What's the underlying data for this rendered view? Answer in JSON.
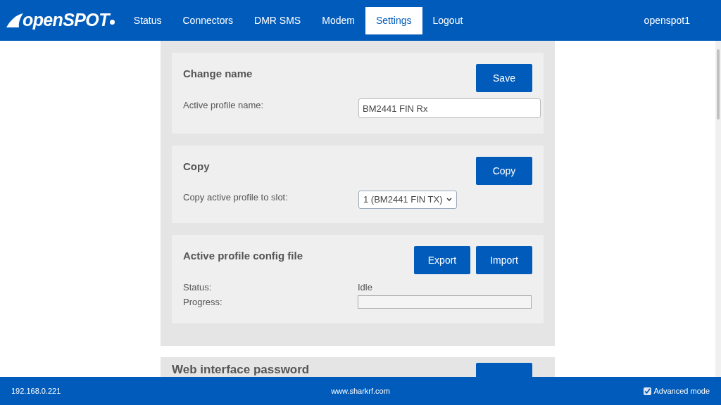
{
  "header": {
    "logo": "openSPOT",
    "nav": [
      {
        "label": "Status",
        "selected": false
      },
      {
        "label": "Connectors",
        "selected": false
      },
      {
        "label": "DMR SMS",
        "selected": false
      },
      {
        "label": "Modem",
        "selected": false
      },
      {
        "label": "Settings",
        "selected": true
      },
      {
        "label": "Logout",
        "selected": false
      }
    ],
    "device": "openspot1"
  },
  "cards": [
    {
      "kind": "name",
      "title": "Change name",
      "buttons": [
        "Save"
      ],
      "label": "Active profile name:",
      "value": "BM2441 FIN Rx"
    },
    {
      "kind": "copy",
      "title": "Copy",
      "buttons": [
        "Copy"
      ],
      "label": "Copy active profile to slot:",
      "value": "1 (BM2441 FIN TX)"
    },
    {
      "kind": "file",
      "title": "Active profile config file",
      "buttons": [
        "Export",
        "Import"
      ],
      "rows": [
        {
          "label": "Status:",
          "value": "Idle"
        },
        {
          "label": "Progress:",
          "level": 0
        }
      ]
    }
  ],
  "next_section": {
    "title": "Web interface password"
  },
  "footer": {
    "ip": "192.168.0.221",
    "site": "www.sharkrf.com",
    "advanced_mode": {
      "label": "Advanced mode",
      "checked": true
    }
  }
}
